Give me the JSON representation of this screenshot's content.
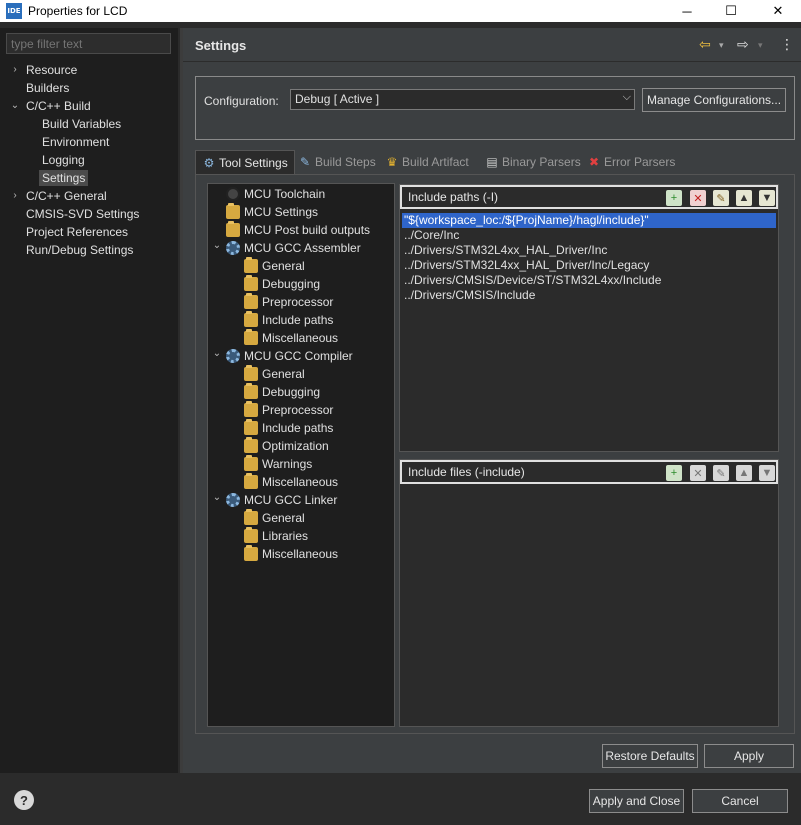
{
  "window": {
    "icon_text": "IDE",
    "title": "Properties for LCD",
    "minimize": "─",
    "maximize": "☐",
    "close": "✕"
  },
  "sidebar": {
    "filter_placeholder": "type filter text",
    "items": [
      {
        "label": "Resource",
        "expandable": true,
        "expanded": false
      },
      {
        "label": "Builders"
      },
      {
        "label": "C/C++ Build",
        "expandable": true,
        "expanded": true
      },
      {
        "label": "Build Variables"
      },
      {
        "label": "Environment"
      },
      {
        "label": "Logging"
      },
      {
        "label": "Settings",
        "selected": true
      },
      {
        "label": "C/C++ General",
        "expandable": true,
        "expanded": false
      },
      {
        "label": "CMSIS-SVD Settings"
      },
      {
        "label": "Project References"
      },
      {
        "label": "Run/Debug Settings"
      }
    ]
  },
  "header": {
    "title": "Settings",
    "back_icon": "⇦",
    "forward_icon": "⇨",
    "menu_icon": "⋮"
  },
  "configuration": {
    "label": "Configuration:",
    "value": "Debug  [ Active ]",
    "manage_button": "Manage Configurations..."
  },
  "tabs": [
    {
      "label": "Tool Settings",
      "active": true,
      "icon": "tool-settings-icon"
    },
    {
      "label": "Build Steps",
      "icon": "build-steps-icon"
    },
    {
      "label": "Build Artifact",
      "icon": "build-artifact-icon"
    },
    {
      "label": "Binary Parsers",
      "icon": "binary-parsers-icon"
    },
    {
      "label": "Error Parsers",
      "icon": "error-parsers-icon"
    }
  ],
  "tool_tree": [
    {
      "label": "MCU Toolchain",
      "icon": "chip"
    },
    {
      "label": "MCU Settings",
      "icon": "folder"
    },
    {
      "label": "MCU Post build outputs",
      "icon": "folder"
    },
    {
      "label": "MCU GCC Assembler",
      "icon": "gear",
      "expanded": true
    },
    {
      "label": "General",
      "icon": "folder"
    },
    {
      "label": "Debugging",
      "icon": "folder"
    },
    {
      "label": "Preprocessor",
      "icon": "folder"
    },
    {
      "label": "Include paths",
      "icon": "folder"
    },
    {
      "label": "Miscellaneous",
      "icon": "folder"
    },
    {
      "label": "MCU GCC Compiler",
      "icon": "gear",
      "expanded": true
    },
    {
      "label": "General",
      "icon": "folder"
    },
    {
      "label": "Debugging",
      "icon": "folder"
    },
    {
      "label": "Preprocessor",
      "icon": "folder"
    },
    {
      "label": "Include paths",
      "icon": "folder"
    },
    {
      "label": "Optimization",
      "icon": "folder"
    },
    {
      "label": "Warnings",
      "icon": "folder"
    },
    {
      "label": "Miscellaneous",
      "icon": "folder"
    },
    {
      "label": "MCU GCC Linker",
      "icon": "gear",
      "expanded": true
    },
    {
      "label": "General",
      "icon": "folder"
    },
    {
      "label": "Libraries",
      "icon": "folder"
    },
    {
      "label": "Miscellaneous",
      "icon": "folder"
    }
  ],
  "include_paths": {
    "title": "Include paths (-I)",
    "items": [
      "\"${workspace_loc:/${ProjName}/hagl/include}\"",
      "../Core/Inc",
      "../Drivers/STM32L4xx_HAL_Driver/Inc",
      "../Drivers/STM32L4xx_HAL_Driver/Inc/Legacy",
      "../Drivers/CMSIS/Device/ST/STM32L4xx/Include",
      "../Drivers/CMSIS/Include"
    ],
    "selected_index": 0
  },
  "include_files": {
    "title": "Include files (-include)",
    "items": []
  },
  "list_toolbar_icons": [
    "add-icon",
    "delete-icon",
    "edit-icon",
    "move-up-icon",
    "move-down-icon"
  ],
  "buttons": {
    "restore_defaults": "Restore Defaults",
    "apply": "Apply",
    "apply_and_close": "Apply and Close",
    "cancel": "Cancel",
    "help": "?"
  },
  "colors": {
    "selection": "#2f65ca",
    "folder": "#d6a940",
    "background": "#3c3f41"
  }
}
